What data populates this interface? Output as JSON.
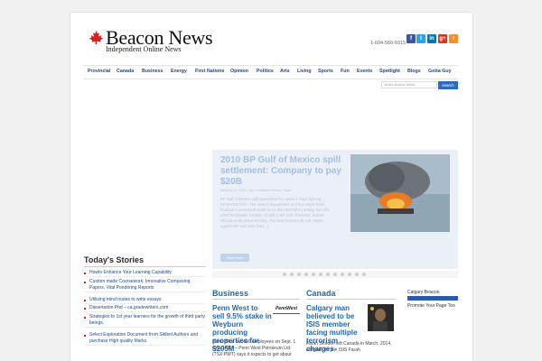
{
  "header": {
    "brand": "Beacon News",
    "tagline": "Independent Online News",
    "phone": "1-604-560-5015",
    "social": [
      {
        "icon": "facebook-icon",
        "letter": "f",
        "color": "#3b5998"
      },
      {
        "icon": "twitter-icon",
        "letter": "t",
        "color": "#2aa3ef"
      },
      {
        "icon": "linkedin-icon",
        "letter": "in",
        "color": "#0e76a8"
      },
      {
        "icon": "googleplus-icon",
        "letter": "g+",
        "color": "#c63d2d"
      },
      {
        "icon": "rss-icon",
        "letter": "r",
        "color": "#f0912c"
      }
    ]
  },
  "nav": [
    "Provincial",
    "Canada",
    "Business",
    "Energy",
    "First Nations",
    "Opinion",
    "Politics",
    "Arts",
    "Living",
    "Sports",
    "Fun",
    "Events",
    "Spotlight",
    "Blogs",
    "Gotta Guy"
  ],
  "search": {
    "placeholder": "enter search terms",
    "button": "search"
  },
  "featured": {
    "title": "2010 BP Gulf of Mexico spill settlement: Company to pay $20B",
    "meta": "October 5, 2015 | By Canadian Press | Tags:",
    "excerpt": "BP Gulf of Mexico spill agreement five years in legal fighting WASHINGTON - The Justice Department and five states have finalized a settlement worth more than $20 billion arising from the 2010 Deepwater Horizon oil spill in the Gulf of Mexico, federal officials announced Monday. The deal resolves all civil claims against BP and ends five [...]",
    "read_more": "Read more"
  },
  "todays_stories": {
    "title": "Today's Stories",
    "items": [
      "Howto Enhance Your Learning Capability",
      "Custom made Coursework: Innovative Composing Papers, Vital Pondering Reports",
      "Utilizing mind routes to write essays",
      "Dissertation Phd – ca.gradewriters.com",
      "Strategies to 1st year learners for the growth of third party beings.",
      "Select Exploration Document from Skilled Authors and purchase High quality Marks"
    ]
  },
  "business": {
    "title": "Business",
    "headline": "Penn West to sell 9.5% stake in Weyburn producing properties for $205M",
    "logo": "PennWest",
    "excerpt": "Penn West out 400 employees on Sept. 1 CALGARY – Penn West Petroleum Ltd. (TSX:PWT) says it expects to get about"
  },
  "canada": {
    "title": "Canada",
    "headline": "Calgary man believed to be ISIS member facing multiple terrorism charges",
    "excerpt": "Farah Shirdon left Canada in March, 2014, allegedly to join ISIS Farah"
  },
  "sidebar_ad": {
    "title": "Calgary Beacon",
    "text": "Promote Your Page Too"
  }
}
